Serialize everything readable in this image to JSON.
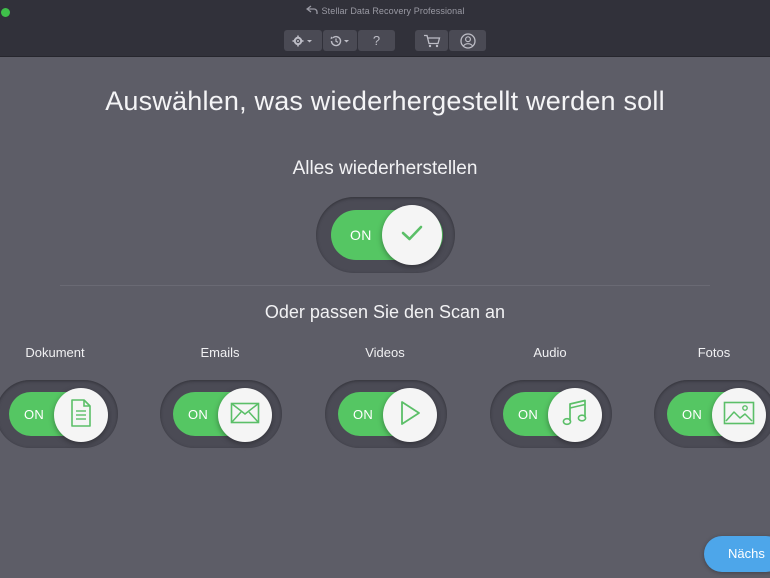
{
  "window": {
    "title": "Stellar Data Recovery Professional",
    "title_icon": "back-arrow-icon"
  },
  "toolbar": {
    "settings_icon": "gear-icon",
    "history_icon": "history-icon",
    "help_label": "?",
    "cart_icon": "cart-icon",
    "account_icon": "user-icon"
  },
  "main": {
    "heading": "Auswählen, was wiederhergestellt werden soll",
    "recover_all": {
      "label": "Alles wiederherstellen",
      "toggle_text": "ON",
      "state": "on",
      "knob_icon": "check-icon"
    },
    "customize_label": "Oder passen Sie den Scan an",
    "categories": [
      {
        "label": "Dokument",
        "toggle_text": "ON",
        "state": "on",
        "icon": "document-icon"
      },
      {
        "label": "Emails",
        "toggle_text": "ON",
        "state": "on",
        "icon": "envelope-icon"
      },
      {
        "label": "Videos",
        "toggle_text": "ON",
        "state": "on",
        "icon": "play-icon"
      },
      {
        "label": "Audio",
        "toggle_text": "ON",
        "state": "on",
        "icon": "music-note-icon"
      },
      {
        "label": "Fotos",
        "toggle_text": "ON",
        "state": "on",
        "icon": "image-icon"
      }
    ],
    "next_button": "Nächs"
  },
  "colors": {
    "background": "#5d5d67",
    "titlebar": "#31313a",
    "toggle_on": "#55c663",
    "icon_green": "#5bbf68",
    "next_button": "#4da6ea"
  }
}
